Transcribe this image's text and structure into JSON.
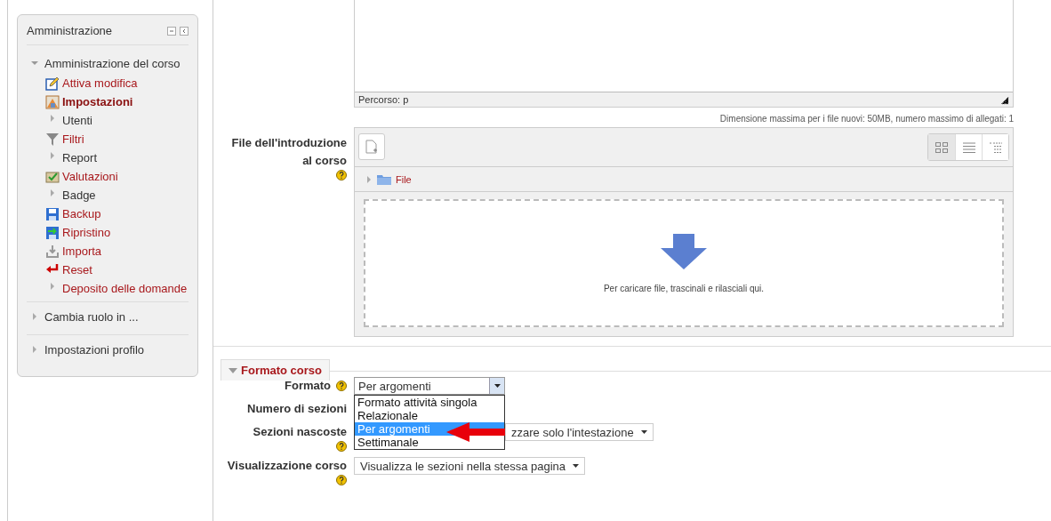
{
  "sidebar": {
    "title": "Amministrazione",
    "tree": [
      {
        "label": "Amministrazione del corso",
        "expanded": true,
        "link": false,
        "children": [
          {
            "label": "Attiva modifica",
            "kind": "edit",
            "link": true,
            "current": false
          },
          {
            "label": "Impostazioni",
            "kind": "settings",
            "link": true,
            "current": true
          },
          {
            "label": "Utenti",
            "kind": "branch",
            "link": false,
            "current": false
          },
          {
            "label": "Filtri",
            "kind": "filter",
            "link": true,
            "current": false
          },
          {
            "label": "Report",
            "kind": "branch",
            "link": false,
            "current": false
          },
          {
            "label": "Valutazioni",
            "kind": "grades",
            "link": true,
            "current": false
          },
          {
            "label": "Badge",
            "kind": "branch",
            "link": false,
            "current": false
          },
          {
            "label": "Backup",
            "kind": "backup",
            "link": true,
            "current": false
          },
          {
            "label": "Ripristino",
            "kind": "restore",
            "link": true,
            "current": false
          },
          {
            "label": "Importa",
            "kind": "import",
            "link": true,
            "current": false
          },
          {
            "label": "Reset",
            "kind": "reset",
            "link": true,
            "current": false
          },
          {
            "label": "Deposito delle domande",
            "kind": "branch",
            "link": true,
            "current": false
          }
        ]
      },
      {
        "label": "Cambia ruolo in ...",
        "expanded": false,
        "link": false
      },
      {
        "label": "Impostazioni profilo",
        "expanded": false,
        "link": false
      }
    ]
  },
  "editor": {
    "path": "Percorso: p"
  },
  "file_field": {
    "label": "File dell'introduzione al corso",
    "help": true,
    "limits": "Dimensione massima per i file nuovi: 50MB, numero massimo di allegati: 1",
    "folder": "File",
    "drop_hint": "Per caricare file, trascinali e rilasciali qui.",
    "views": [
      {
        "kind": "icons",
        "selected": true
      },
      {
        "kind": "list",
        "selected": false
      },
      {
        "kind": "tree",
        "selected": false
      }
    ]
  },
  "section": {
    "title": "Formato corso",
    "expanded": true,
    "fields": [
      {
        "label": "Formato",
        "help": true,
        "value": "Per argomenti",
        "open": true,
        "options": [
          {
            "label": "Formato attività singola",
            "selected": false
          },
          {
            "label": "Relazionale",
            "selected": false
          },
          {
            "label": "Per argomenti",
            "selected": true
          },
          {
            "label": "Settimanale",
            "selected": false
          }
        ]
      },
      {
        "label": "Numero di sezioni",
        "help": false
      },
      {
        "label": "Sezioni nascoste",
        "help": true,
        "value": "zzare solo l'intestazione"
      },
      {
        "label": "Visualizzazione corso",
        "help": true,
        "value": "Visualizza le sezioni nella stessa pagina"
      }
    ]
  }
}
